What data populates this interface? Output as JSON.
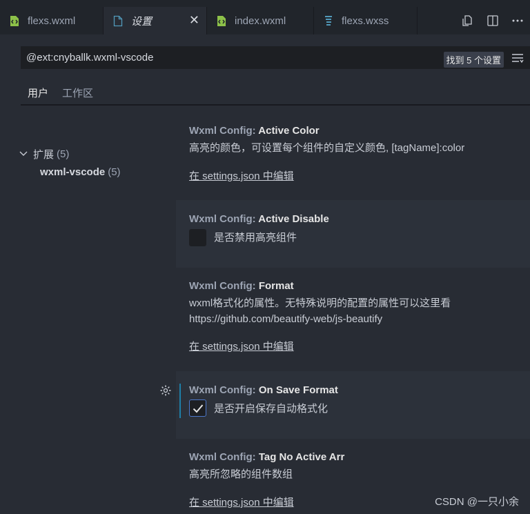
{
  "tabs": [
    {
      "label": "flexs.wxml",
      "icon": "file-code-icon",
      "active": false
    },
    {
      "label": "设置",
      "icon": "file-icon",
      "active": true
    },
    {
      "label": "index.wxml",
      "icon": "file-code-icon",
      "active": false
    },
    {
      "label": "flexs.wxss",
      "icon": "css-icon",
      "active": false
    }
  ],
  "colors": {
    "accent": "#4d78cc",
    "modified_bar": "#1e7fa8",
    "file_icon_green": "#8dc149",
    "css_icon_blue": "#519aba"
  },
  "search": {
    "value": "@ext:cnyballk.wxml-vscode",
    "result_count": "找到 5 个设置"
  },
  "scopes": [
    {
      "label": "用户",
      "active": true
    },
    {
      "label": "工作区",
      "active": false
    }
  ],
  "tree": {
    "group": {
      "label": "扩展",
      "count": "(5)"
    },
    "child": {
      "label": "wxml-vscode",
      "count": "(5)"
    }
  },
  "settings": [
    {
      "category": "Wxml Config: ",
      "name": "Active Color",
      "desc": "高亮的颜色，可设置每个组件的自定义颜色, [tagName]:color",
      "edit": "在 settings.json 中编辑"
    },
    {
      "category": "Wxml Config: ",
      "name": "Active Disable",
      "checkbox_label": "是否禁用高亮组件",
      "checked": false
    },
    {
      "category": "Wxml Config: ",
      "name": "Format",
      "desc1": "wxml格式化的属性。无特殊说明的配置的属性可以这里看",
      "desc2": "https://github.com/beautify-web/js-beautify",
      "edit": "在 settings.json 中编辑"
    },
    {
      "category": "Wxml Config: ",
      "name": "On Save Format",
      "checkbox_label": "是否开启保存自动格式化",
      "checked": true
    },
    {
      "category": "Wxml Config: ",
      "name": "Tag No Active Arr",
      "desc": "高亮所忽略的组件数组",
      "edit": "在 settings.json 中编辑"
    }
  ],
  "watermark": "CSDN @一只小余"
}
